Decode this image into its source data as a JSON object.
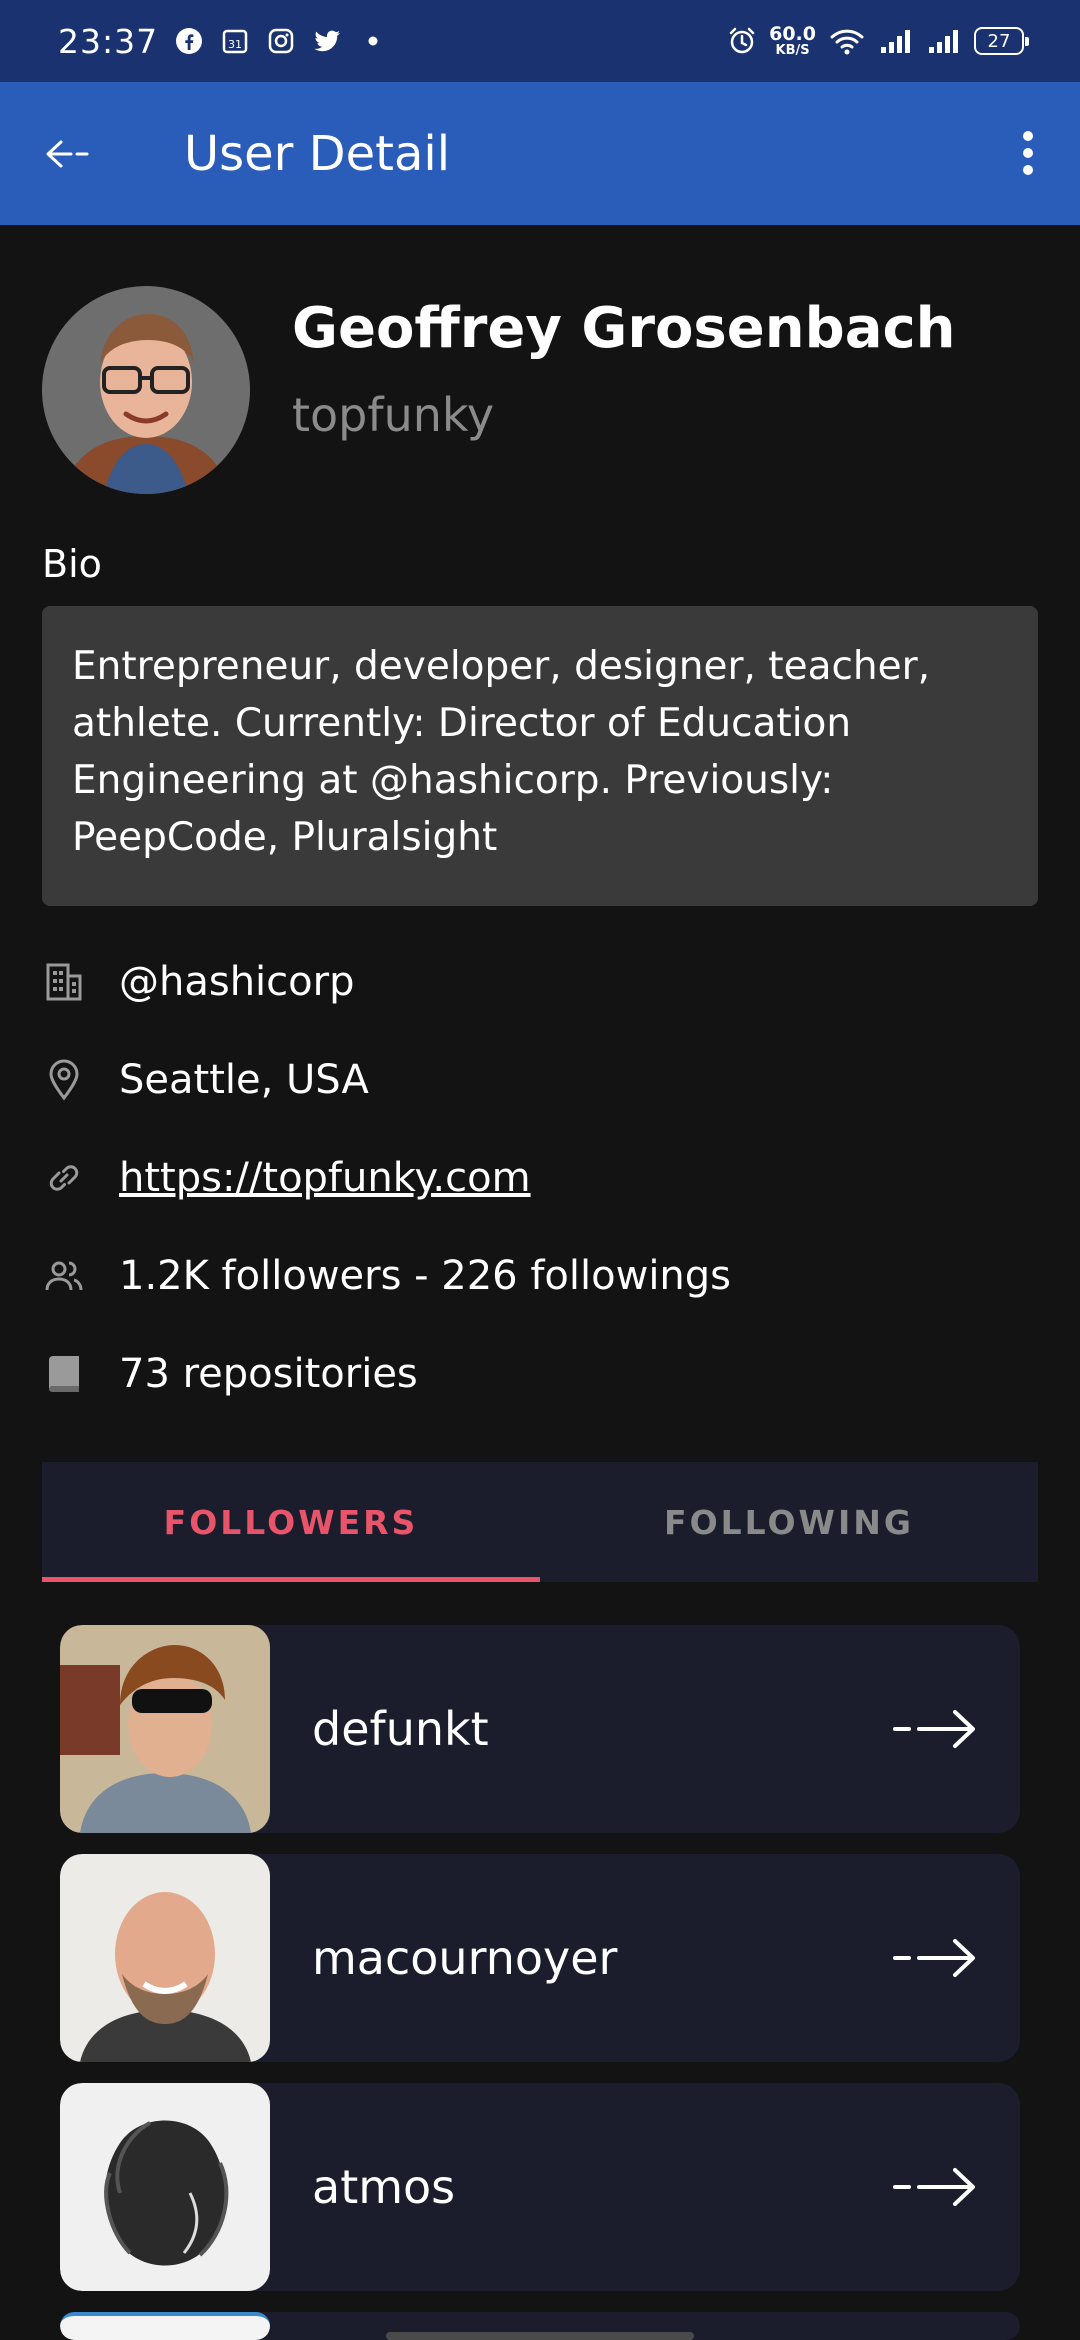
{
  "status_bar": {
    "time": "23:37",
    "net_speed_value": "60.0",
    "net_speed_unit": "KB/S",
    "battery": "27"
  },
  "app_bar": {
    "title": "User Detail"
  },
  "profile": {
    "name": "Geoffrey Grosenbach",
    "login": "topfunky",
    "bio_label": "Bio",
    "bio": "Entrepreneur, developer, designer, teacher, athlete. Currently: Director of Education Engineering at @hashicorp. Previously: PeepCode, Pluralsight",
    "company": "@hashicorp",
    "location": "Seattle, USA",
    "blog": "https://topfunky.com",
    "follow_stats": "1.2K followers - 226 followings",
    "repositories": "73 repositories"
  },
  "tabs": [
    {
      "label": "FOLLOWERS",
      "active": true
    },
    {
      "label": "FOLLOWING",
      "active": false
    }
  ],
  "followers": [
    {
      "login": "defunkt"
    },
    {
      "login": "macournoyer"
    },
    {
      "login": "atmos"
    }
  ],
  "colors": {
    "status_bar": "#1a3270",
    "app_bar": "#2a5db9",
    "background": "#131313",
    "card": "#1b1d2d",
    "accent": "#e8546a",
    "bio_box": "#3a3a3a"
  }
}
